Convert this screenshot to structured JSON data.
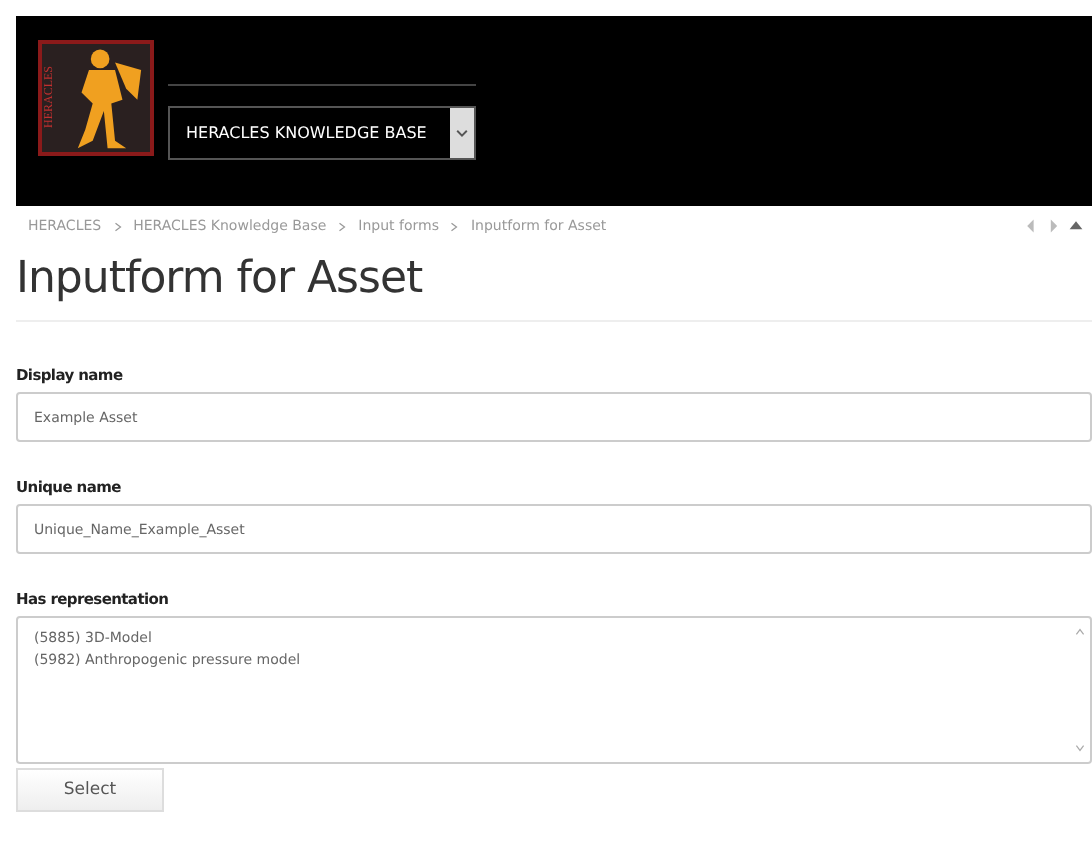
{
  "header": {
    "logo_text": "HERACLES",
    "selector": {
      "value": "HERACLES KNOWLEDGE BASE"
    }
  },
  "breadcrumb": [
    "HERACLES",
    "HERACLES Knowledge Base",
    "Input forms",
    "Inputform for Asset"
  ],
  "title": "Inputform for Asset",
  "fields": [
    {
      "label": "Display name",
      "kind": "text",
      "value": "Example Asset"
    },
    {
      "label": "Unique name",
      "kind": "text",
      "value": "Unique_Name_Example_Asset"
    },
    {
      "label": "Has representation",
      "kind": "list",
      "items": [
        "(5885) 3D-Model",
        "(5982) Anthropogenic pressure model"
      ]
    }
  ],
  "buttons": [
    "Select"
  ]
}
